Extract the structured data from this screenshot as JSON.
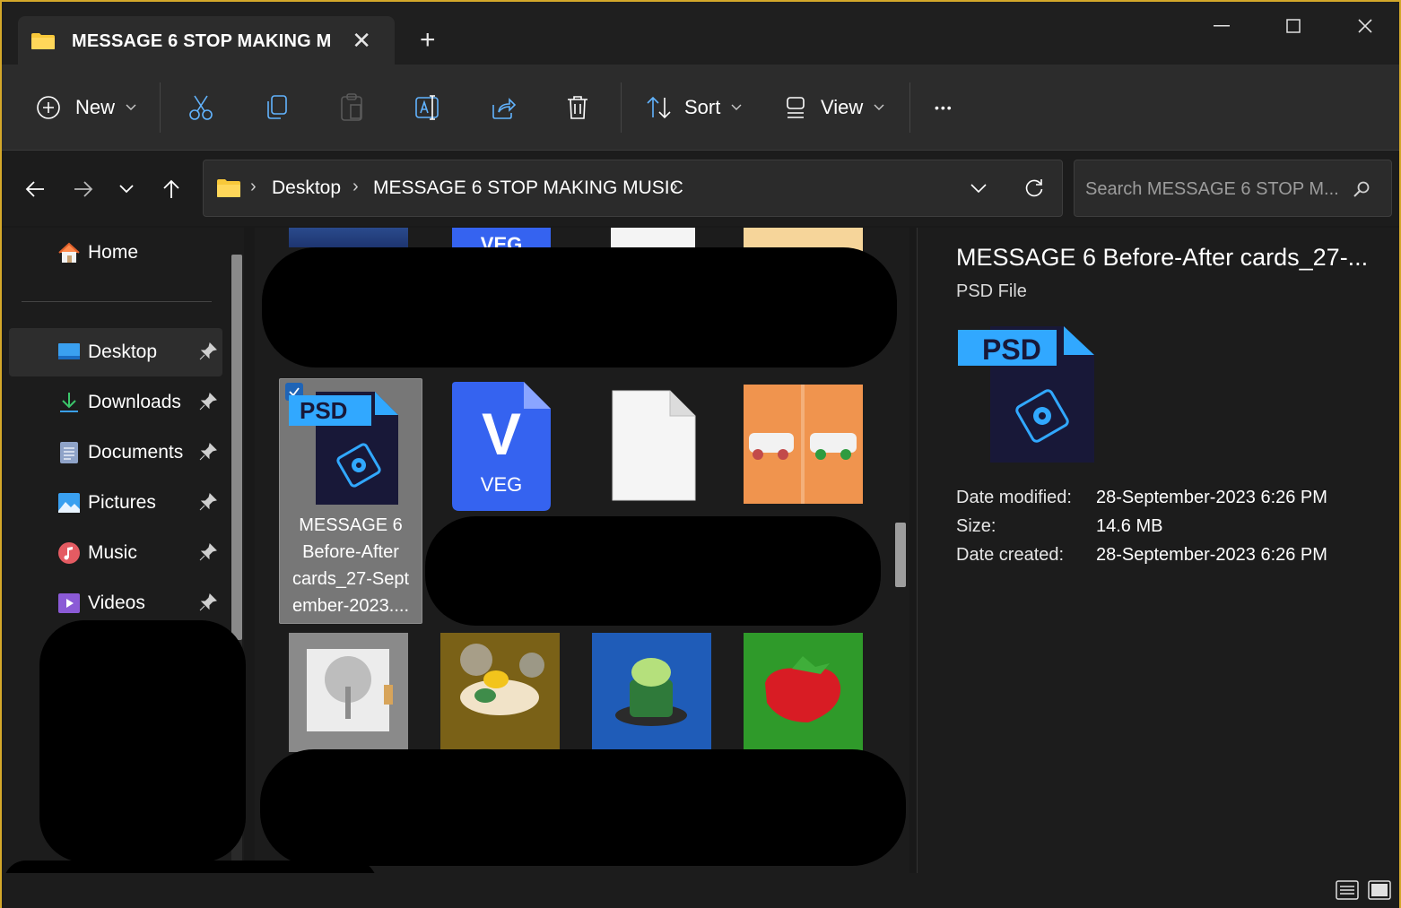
{
  "tab": {
    "title": "MESSAGE 6 STOP MAKING MI",
    "close_glyph": "✕",
    "new_tab_glyph": "+"
  },
  "toolbar": {
    "new_label": "New",
    "sort_label": "Sort",
    "view_label": "View",
    "more_glyph": "•••"
  },
  "address": {
    "crumbs": [
      "Desktop",
      "MESSAGE 6 STOP MAKING MUSIC"
    ],
    "separator": "›"
  },
  "search": {
    "placeholder": "Search MESSAGE 6 STOP M..."
  },
  "sidebar": {
    "home": "Home",
    "items": [
      {
        "label": "Desktop"
      },
      {
        "label": "Downloads"
      },
      {
        "label": "Documents"
      },
      {
        "label": "Pictures"
      },
      {
        "label": "Music"
      },
      {
        "label": "Videos"
      }
    ]
  },
  "files": {
    "psd_badge": "PSD",
    "veg_badge": "VEG",
    "veg_letter": "V",
    "selected_name": "MESSAGE 6 Before-After cards_27-Sept ember-2023....",
    "selected_lines": [
      "MESSAGE 6",
      "Before-After",
      "cards_27-Sept",
      "ember-2023...."
    ]
  },
  "details": {
    "title": "MESSAGE 6 Before-After cards_27-...",
    "type": "PSD File",
    "psd_badge": "PSD",
    "rows": [
      {
        "label": "Date modified:",
        "value": "28-September-2023 6:26 PM"
      },
      {
        "label": "Size:",
        "value": "14.6 MB"
      },
      {
        "label": "Date created:",
        "value": "28-September-2023 6:26 PM"
      }
    ]
  },
  "colors": {
    "accent_border": "#d4a82a",
    "psd_blue": "#31a8ff",
    "psd_dark": "#181838",
    "veg_blue": "#3563f0",
    "selection": "#1f64b6"
  }
}
